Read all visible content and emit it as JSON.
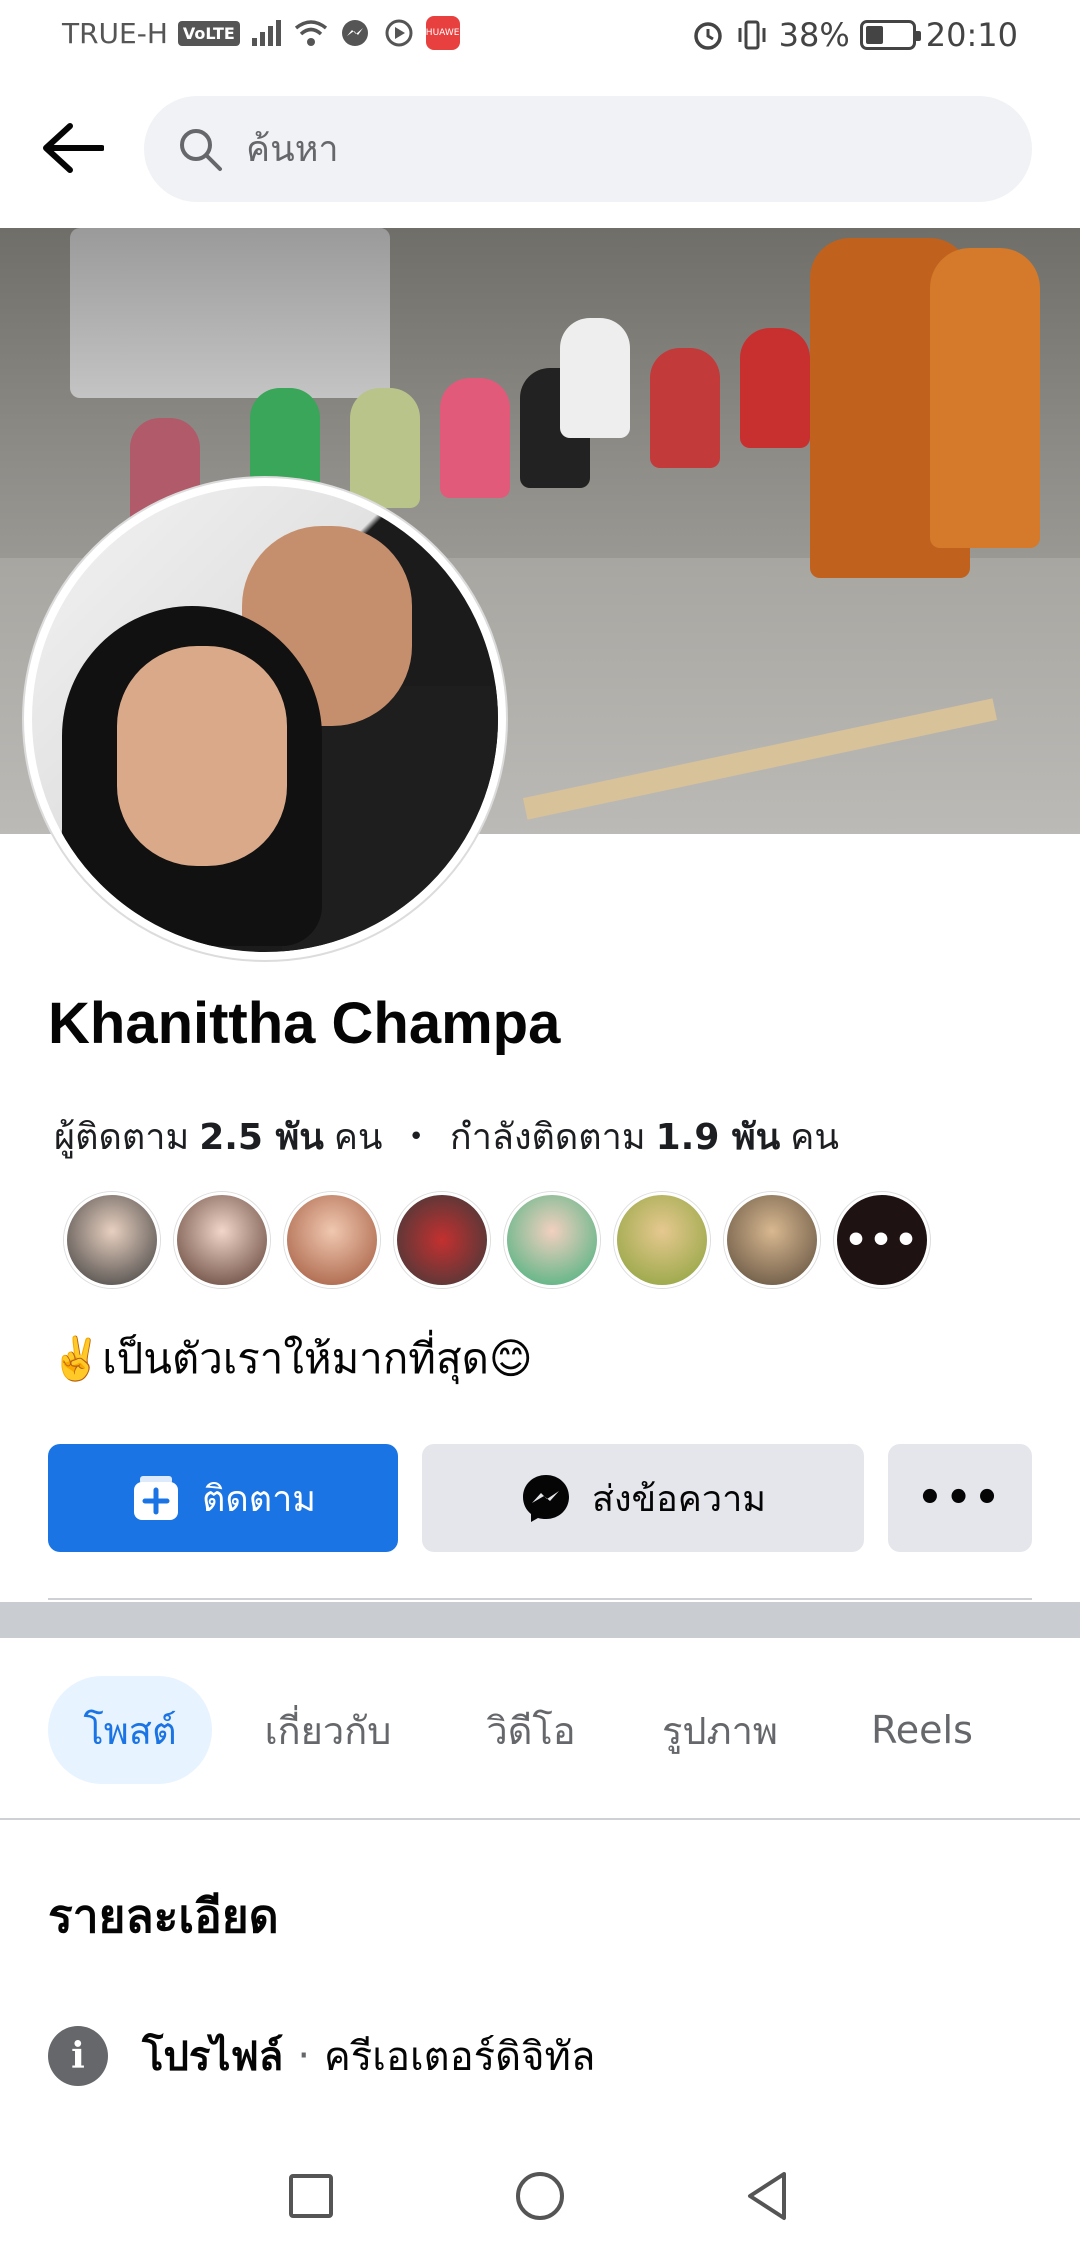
{
  "status": {
    "carrier": "TRUE-H",
    "volte": "VoLTE",
    "huawei": "HUAWEI",
    "battery": "38%",
    "battery_level": 0.38,
    "time": "20:10"
  },
  "search": {
    "placeholder": "ค้นหา"
  },
  "profile": {
    "name": "Khanittha Champa",
    "followers_label": "ผู้ติดตาม",
    "followers_value": "2.5 พัน",
    "followers_unit": "คน",
    "following_label": "กำลังติดตาม",
    "following_value": "1.9 พัน",
    "following_unit": "คน",
    "bio": "✌️เป็นตัวเราให้มากที่สุด😊",
    "more_friends": "•••"
  },
  "actions": {
    "follow": "ติดตาม",
    "message": "ส่งข้อความ",
    "more": "•••"
  },
  "tabs": [
    {
      "label": "โพสต์",
      "active": true
    },
    {
      "label": "เกี่ยวกับ",
      "active": false
    },
    {
      "label": "วิดีโอ",
      "active": false
    },
    {
      "label": "รูปภาพ",
      "active": false
    },
    {
      "label": "Reels",
      "active": false
    }
  ],
  "details": {
    "title": "รายละเอียด",
    "profile_label": "โปรไฟล์",
    "separator": "·",
    "profile_value": "ครีเอเตอร์ดิจิทัล"
  },
  "colors": {
    "primary": "#1b74e4",
    "secondary_bg": "#e4e6eb",
    "tab_active_bg": "#e7f3ff"
  }
}
